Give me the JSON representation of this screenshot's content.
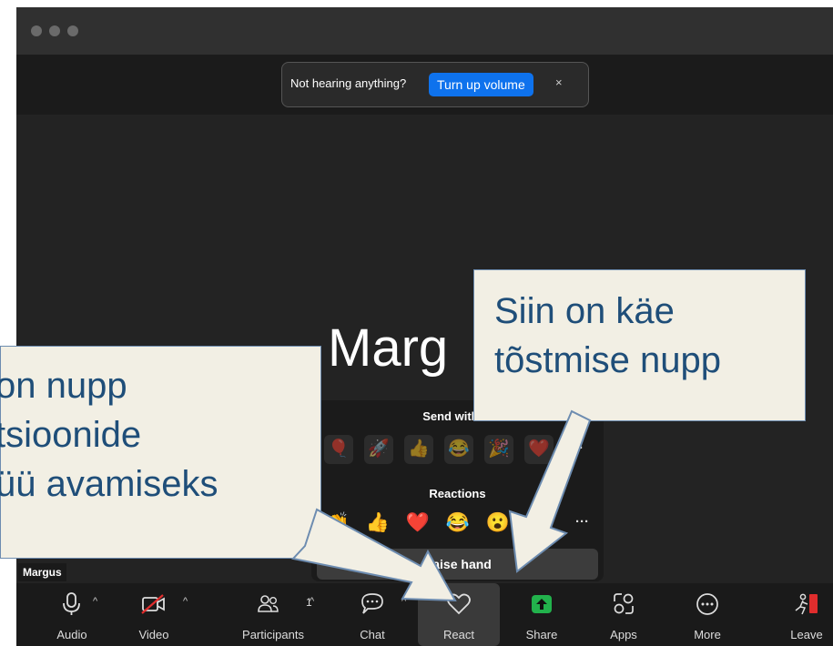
{
  "notification": {
    "text": "Not hearing anything?",
    "button": "Turn up volume",
    "close": "×"
  },
  "participant_display_name": "Marg",
  "participant_tag": "Margus",
  "reactions_popup": {
    "effects_heading": "Send with ef",
    "effects": [
      "🎈",
      "🚀",
      "👍",
      "😂",
      "🎉",
      "❤️"
    ],
    "reactions_heading": "Reactions",
    "reactions": [
      "👏",
      "👍",
      "❤️",
      "😂",
      "😮"
    ],
    "more": "···",
    "raise_hand": "Raise hand"
  },
  "toolbar": {
    "items": [
      {
        "label": "Audio",
        "icon": "microphone-icon"
      },
      {
        "label": "Video",
        "icon": "video-off-icon"
      },
      {
        "label": "Participants",
        "icon": "participants-icon",
        "count": "1"
      },
      {
        "label": "Chat",
        "icon": "chat-icon"
      },
      {
        "label": "React",
        "icon": "heart-icon"
      },
      {
        "label": "Share",
        "icon": "share-icon"
      },
      {
        "label": "Apps",
        "icon": "apps-icon"
      },
      {
        "label": "More",
        "icon": "more-icon"
      },
      {
        "label": "Leave",
        "icon": "leave-icon"
      }
    ],
    "caret": "^"
  },
  "callouts": {
    "left": [
      "on nupp",
      "tsioonide",
      "üü avamiseks"
    ],
    "right": [
      "Siin on käe",
      "tõstmise nupp"
    ]
  },
  "colors": {
    "accent": "#0e72ed",
    "share_green": "#22b24c",
    "leave_red": "#e02d2d",
    "callout_text": "#1f4e79",
    "callout_bg": "#f2efe4"
  }
}
